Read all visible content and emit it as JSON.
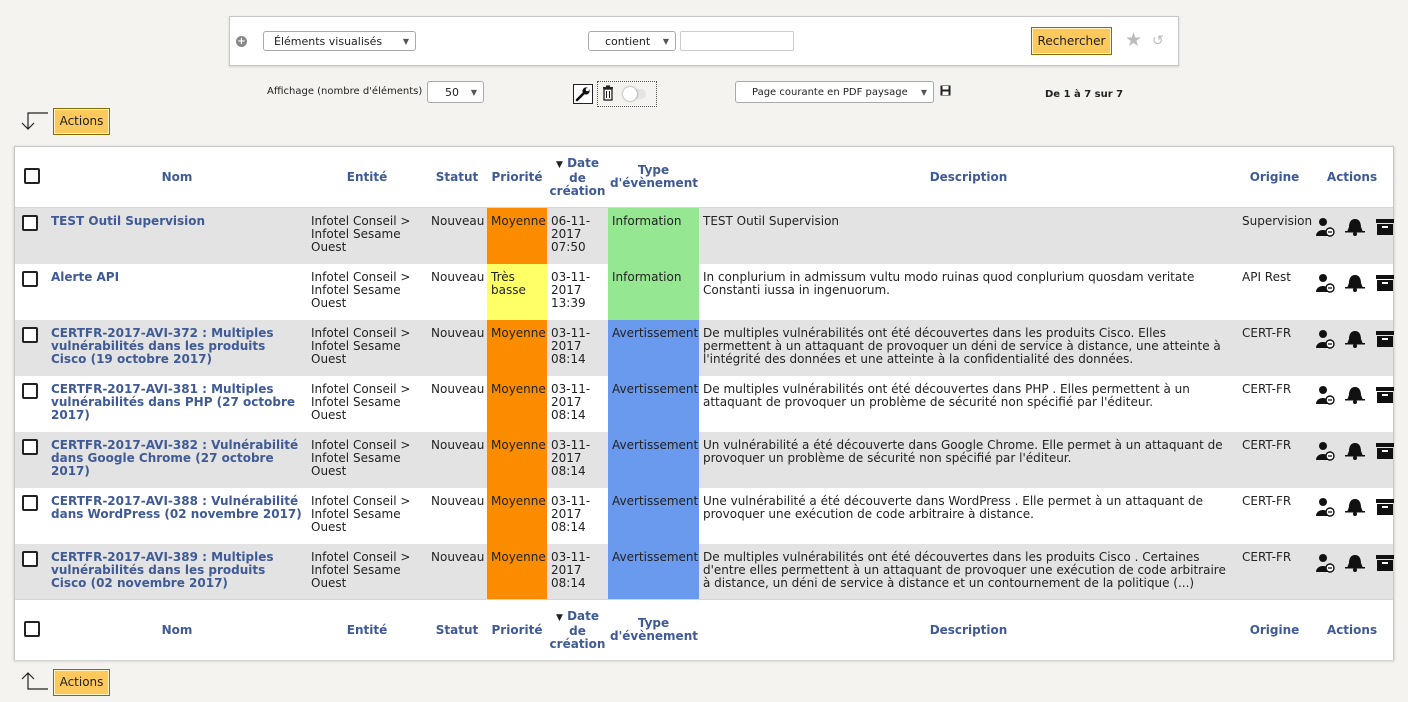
{
  "search": {
    "criteria_select": "Éléments visualisés",
    "operator_select": "contient",
    "value": "",
    "search_button": "Rechercher"
  },
  "toolbar": {
    "display_label": "Affichage (nombre d'éléments)",
    "page_size": "50",
    "export_select": "Page courante en PDF paysage",
    "pager_text": "De 1 à 7 sur 7",
    "actions_label": "Actions"
  },
  "table": {
    "headers": {
      "nom": "Nom",
      "entite": "Entité",
      "statut": "Statut",
      "priorite": "Priorité",
      "date_line1": "Date",
      "date_line2": "de",
      "date_line3": "création",
      "type_line1": "Type",
      "type_line2": "d'évènement",
      "description": "Description",
      "origine": "Origine",
      "actions": "Actions"
    },
    "rows": [
      {
        "nom": "TEST Outil Supervision",
        "entite": "Infotel Conseil > Infotel Sesame Ouest",
        "statut": "Nouveau",
        "priorite": "Moyenne",
        "date": "06-11-2017 07:50",
        "type": "Information",
        "description": "TEST Outil Supervision",
        "origine": "Supervision"
      },
      {
        "nom": "Alerte API",
        "entite": "Infotel Conseil > Infotel Sesame Ouest",
        "statut": "Nouveau",
        "priorite": "Très basse",
        "date": "03-11-2017 13:39",
        "type": "Information",
        "description": "In conplurium in admissum vultu modo ruinas quod conplurium quosdam veritate Constanti iussa in ingenuorum.",
        "origine": "API Rest"
      },
      {
        "nom": "CERTFR-2017-AVI-372 : Multiples vulnérabilités dans les produits Cisco (19 octobre 2017)",
        "entite": "Infotel Conseil > Infotel Sesame Ouest",
        "statut": "Nouveau",
        "priorite": "Moyenne",
        "date": "03-11-2017 08:14",
        "type": "Avertissement",
        "description": "De multiples vulnérabilités ont été découvertes dans les produits Cisco. Elles permettent à un attaquant de provoquer un déni de service à distance, une atteinte à l'intégrité des données et une atteinte à la confidentialité des données.",
        "origine": "CERT-FR"
      },
      {
        "nom": "CERTFR-2017-AVI-381 : Multiples vulnérabilités dans PHP (27 octobre 2017)",
        "entite": "Infotel Conseil > Infotel Sesame Ouest",
        "statut": "Nouveau",
        "priorite": "Moyenne",
        "date": "03-11-2017 08:14",
        "type": "Avertissement",
        "description": "De multiples vulnérabilités ont été découvertes dans PHP . Elles permettent à un attaquant de provoquer un problème de sécurité non spécifié par l'éditeur.",
        "origine": "CERT-FR"
      },
      {
        "nom": "CERTFR-2017-AVI-382 : Vulnérabilité dans Google Chrome (27 octobre 2017)",
        "entite": "Infotel Conseil > Infotel Sesame Ouest",
        "statut": "Nouveau",
        "priorite": "Moyenne",
        "date": "03-11-2017 08:14",
        "type": "Avertissement",
        "description": "Un vulnérabilité a été découverte dans Google Chrome. Elle permet à un attaquant de provoquer un problème de sécurité non spécifié par l'éditeur.",
        "origine": "CERT-FR"
      },
      {
        "nom": "CERTFR-2017-AVI-388 : Vulnérabilité dans WordPress (02 novembre 2017)",
        "entite": "Infotel Conseil > Infotel Sesame Ouest",
        "statut": "Nouveau",
        "priorite": "Moyenne",
        "date": "03-11-2017 08:14",
        "type": "Avertissement",
        "description": "Une vulnérabilité a été découverte dans WordPress . Elle permet à un attaquant de provoquer une exécution de code arbitraire à distance.",
        "origine": "CERT-FR"
      },
      {
        "nom": "CERTFR-2017-AVI-389 : Multiples vulnérabilités dans les produits Cisco (02 novembre 2017)",
        "entite": "Infotel Conseil > Infotel Sesame Ouest",
        "statut": "Nouveau",
        "priorite": "Moyenne",
        "date": "03-11-2017 08:14",
        "type": "Avertissement",
        "description": "De multiples vulnérabilités ont été découvertes dans les produits Cisco . Certaines d'entre elles permettent à un attaquant de provoquer une exécution de code arbitraire à distance, un déni de service à distance et un contournement de la politique (...)",
        "origine": "CERT-FR"
      }
    ]
  },
  "colors": {
    "priority_moyenne": "#fb8c00",
    "priority_tres_basse": "#ffff66",
    "type_information": "#95e891",
    "type_avertissement": "#6a9aee",
    "accent_button": "#fec95c",
    "link": "#3f5a96"
  },
  "icons": [
    "plus-icon",
    "star-icon",
    "reset-icon",
    "wrench-icon",
    "trash-icon",
    "toggle",
    "save-icon",
    "arrow-down-icon",
    "arrow-up-icon",
    "assign-user-icon",
    "bell-icon",
    "archive-icon"
  ]
}
